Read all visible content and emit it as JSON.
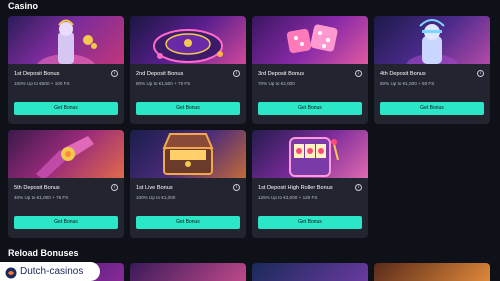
{
  "sections": {
    "casino": "Casino",
    "reload": "Reload Bonuses"
  },
  "cards": [
    {
      "title": "1st Deposit Bonus",
      "subtitle": "100% Up to €500 + 100 FS",
      "button": "Get Bonus"
    },
    {
      "title": "2nd Deposit Bonus",
      "subtitle": "80% Up to €1,500 + 75 FS",
      "button": "Get Bonus"
    },
    {
      "title": "3rd Deposit Bonus",
      "subtitle": "70% Up to €2,000",
      "button": "Get Bonus"
    },
    {
      "title": "4th Deposit Bonus",
      "subtitle": "60% Up to €1,000 + 50 FS",
      "button": "Get Bonus"
    },
    {
      "title": "5th Deposit Bonus",
      "subtitle": "40% Up to €1,000 + 75 FS",
      "button": "Get Bonus"
    },
    {
      "title": "1st Live Bonus",
      "subtitle": "100% Up to €1,000",
      "button": "Get Bonus"
    },
    {
      "title": "1st Deposit High Roller Bonus",
      "subtitle": "125% Up to €3,000 + 125 FS",
      "button": "Get Bonus"
    }
  ],
  "info_icon_glyph": "i",
  "logo": {
    "text": "Dutch-casinos"
  },
  "colors": {
    "background": "#0f1119",
    "card": "#222530",
    "accent": "#2ce6c8"
  }
}
